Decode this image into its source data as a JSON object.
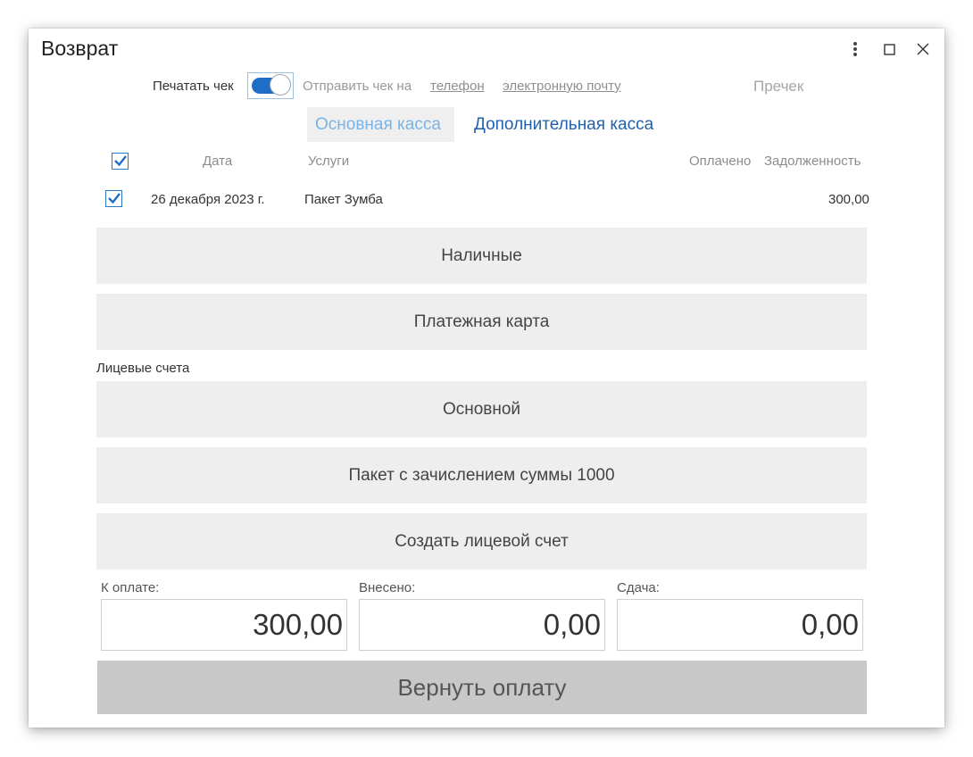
{
  "window": {
    "title": "Возврат",
    "icons": [
      "more-vert-icon",
      "maximize-icon",
      "close-icon"
    ]
  },
  "receipt": {
    "print_label": "Печатать чек",
    "print_enabled": true,
    "send_label": "Отправить чек на",
    "phone_link": "телефон",
    "email_link": "электронную почту",
    "precheck": "Пречек"
  },
  "tabs": [
    {
      "label": "Основная касса",
      "active": true
    },
    {
      "label": "Дополнительная касса",
      "active": false
    }
  ],
  "table": {
    "columns": {
      "date": "Дата",
      "services": "Услуги",
      "paid": "Оплачено",
      "debt": "Задолженность"
    },
    "rows": [
      {
        "checked": true,
        "date": "26 декабря 2023 г.",
        "service": "Пакет Зумба",
        "paid": "",
        "debt": "300,00"
      }
    ]
  },
  "payment_methods": {
    "cash": "Наличные",
    "card": "Платежная карта"
  },
  "accounts": {
    "section_label": "Лицевые счета",
    "items": [
      "Основной",
      "Пакет с зачислением суммы 1000"
    ],
    "create": "Создать лицевой счет"
  },
  "totals": {
    "to_pay_label": "К оплате:",
    "to_pay_value": "300,00",
    "deposited_label": "Внесено:",
    "deposited_value": "0,00",
    "change_label": "Сдача:",
    "change_value": "0,00"
  },
  "refund_button": "Вернуть оплату",
  "colors": {
    "accent": "#1e6ec8",
    "tab_active_text": "#78b4e8",
    "tab_inactive_text": "#2161ad",
    "button_bg": "#eeeeee",
    "refund_bg": "#c8c8c8"
  }
}
